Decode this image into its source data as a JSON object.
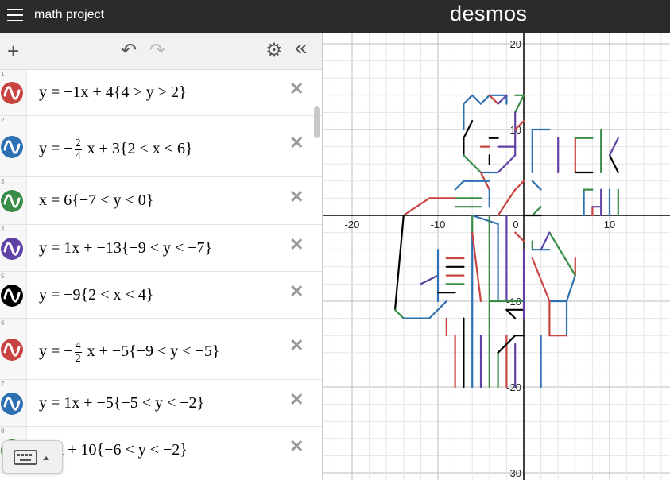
{
  "app": {
    "title": "math project",
    "brand": "desmos"
  },
  "toolbar": {
    "add": "+",
    "undo": "↶",
    "redo": "↷",
    "settings": "⚙",
    "collapse": "«"
  },
  "colors": {
    "red": "#c74440",
    "blue": "#2d70b3",
    "green": "#388c46",
    "purple": "#6042a6",
    "black": "#000000"
  },
  "expressions": [
    {
      "num": "1",
      "color": "red",
      "latex": "y = −1x + 4{4 > y > 2}"
    },
    {
      "num": "2",
      "color": "blue",
      "latex": "y = −⁄ x + 3{2 < x < 6}",
      "frac": [
        "2",
        "4"
      ]
    },
    {
      "num": "3",
      "color": "green",
      "latex": "x = 6{−7 < y < 0}"
    },
    {
      "num": "4",
      "color": "purple",
      "latex": "y = 1x + −13{−9 < y < −7}"
    },
    {
      "num": "5",
      "color": "black",
      "latex": "y = −9{2 < x < 4}"
    },
    {
      "num": "6",
      "color": "red",
      "latex": "y = −⁄ x + −5{−9 < y < −5}",
      "frac": [
        "4",
        "2"
      ]
    },
    {
      "num": "7",
      "color": "blue",
      "latex": "y = 1x + −5{−5 < y < −2}"
    },
    {
      "num": "8",
      "color": "green",
      "latex": "−4x + 10{−6 < y < −2}"
    }
  ],
  "graph": {
    "x_ticks": [
      "-20",
      "-10",
      "0",
      "10"
    ],
    "y_ticks": [
      "20",
      "10",
      "-10",
      "-20",
      "-30"
    ]
  }
}
